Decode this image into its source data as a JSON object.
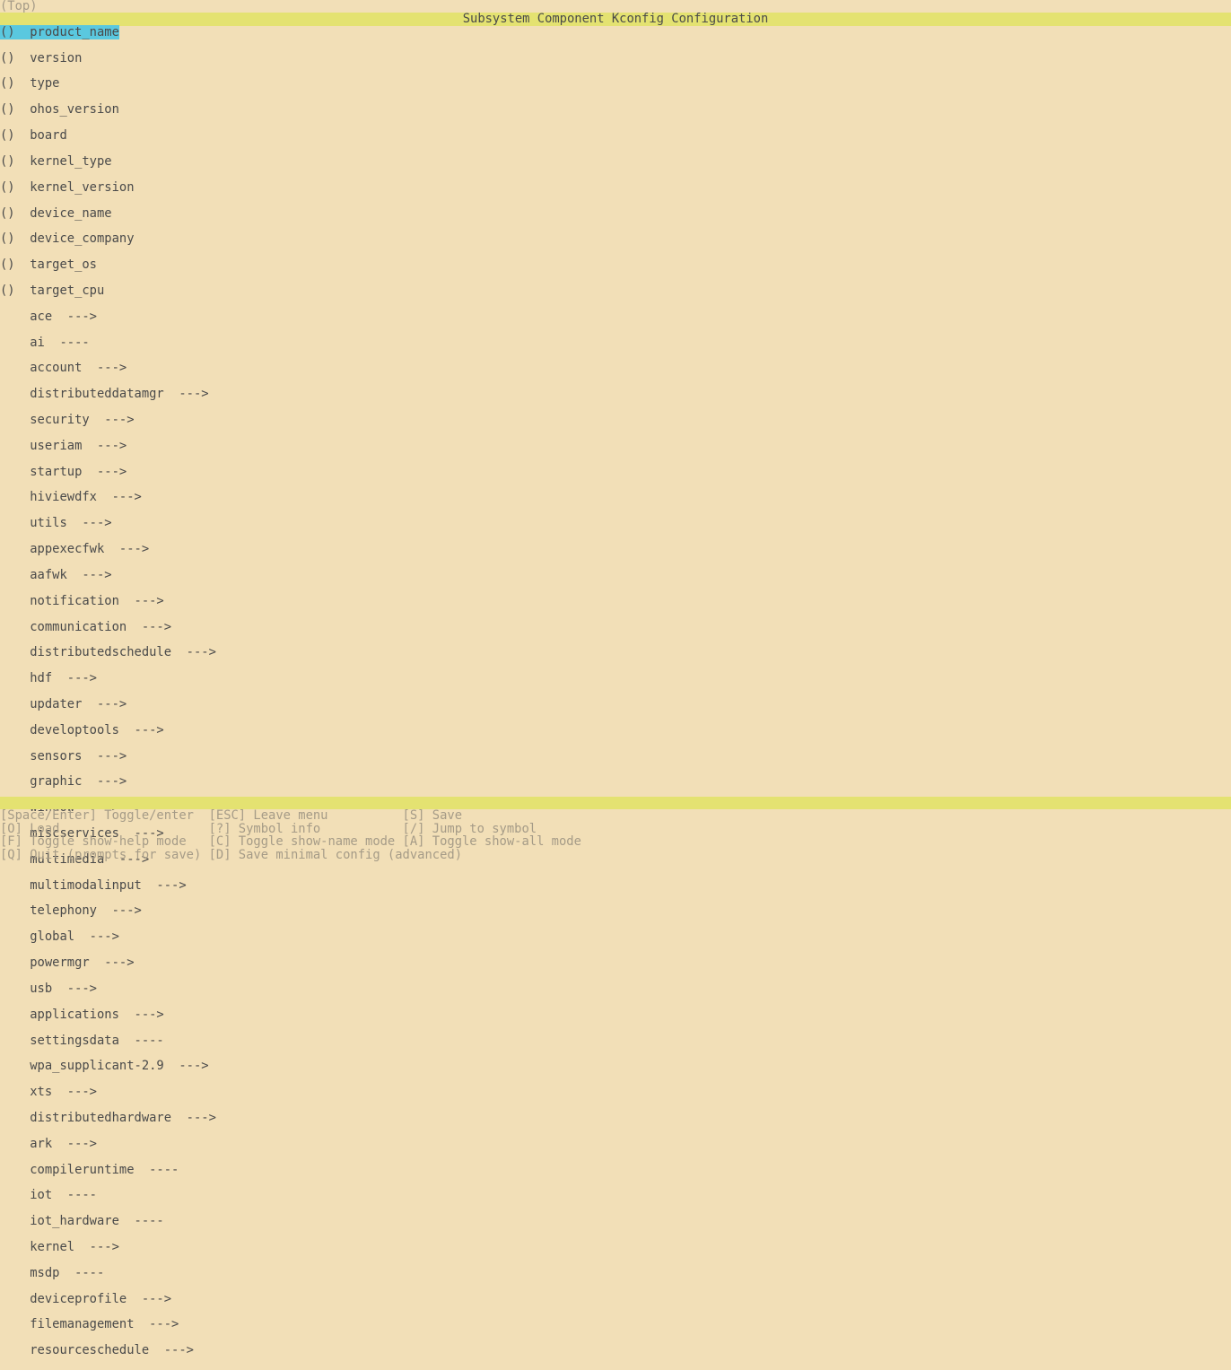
{
  "breadcrumb": "(Top)",
  "title": "Subsystem Component Kconfig Configuration",
  "string_items": [
    "product_name",
    "version",
    "type",
    "ohos_version",
    "board",
    "kernel_type",
    "kernel_version",
    "device_name",
    "device_company",
    "target_os",
    "target_cpu"
  ],
  "submenu_items": [
    {
      "name": "ace",
      "arrow": " --->"
    },
    {
      "name": "ai",
      "arrow": " ----"
    },
    {
      "name": "account",
      "arrow": " --->"
    },
    {
      "name": "distributeddatamgr",
      "arrow": " --->"
    },
    {
      "name": "security",
      "arrow": " --->"
    },
    {
      "name": "useriam",
      "arrow": " --->"
    },
    {
      "name": "startup",
      "arrow": " --->"
    },
    {
      "name": "hiviewdfx",
      "arrow": " --->"
    },
    {
      "name": "utils",
      "arrow": " --->"
    },
    {
      "name": "appexecfwk",
      "arrow": " --->"
    },
    {
      "name": "aafwk",
      "arrow": " --->"
    },
    {
      "name": "notification",
      "arrow": " --->"
    },
    {
      "name": "communication",
      "arrow": " --->"
    },
    {
      "name": "distributedschedule",
      "arrow": " --->"
    },
    {
      "name": "hdf",
      "arrow": " --->"
    },
    {
      "name": "updater",
      "arrow": " --->"
    },
    {
      "name": "developtools",
      "arrow": " --->"
    },
    {
      "name": "sensors",
      "arrow": " --->"
    },
    {
      "name": "graphic",
      "arrow": " --->"
    },
    {
      "name": "window",
      "arrow": " --->"
    },
    {
      "name": "miscservices",
      "arrow": " --->"
    },
    {
      "name": "multimedia",
      "arrow": " --->"
    },
    {
      "name": "multimodalinput",
      "arrow": " --->"
    },
    {
      "name": "telephony",
      "arrow": " --->"
    },
    {
      "name": "global",
      "arrow": " --->"
    },
    {
      "name": "powermgr",
      "arrow": " --->"
    },
    {
      "name": "usb",
      "arrow": " --->"
    },
    {
      "name": "applications",
      "arrow": " --->"
    },
    {
      "name": "settingsdata",
      "arrow": " ----"
    },
    {
      "name": "wpa_supplicant-2.9",
      "arrow": " --->"
    },
    {
      "name": "xts",
      "arrow": " --->"
    },
    {
      "name": "distributedhardware",
      "arrow": " --->"
    },
    {
      "name": "ark",
      "arrow": " --->"
    },
    {
      "name": "compileruntime",
      "arrow": " ----"
    },
    {
      "name": "iot",
      "arrow": " ----"
    },
    {
      "name": "iot_hardware",
      "arrow": " ----"
    },
    {
      "name": "kernel",
      "arrow": " --->"
    },
    {
      "name": "msdp",
      "arrow": " ----"
    },
    {
      "name": "deviceprofile",
      "arrow": " --->"
    },
    {
      "name": "filemanagement",
      "arrow": " --->"
    },
    {
      "name": "resourceschedule",
      "arrow": " --->"
    }
  ],
  "help_lines": [
    "[Space/Enter] Toggle/enter  [ESC] Leave menu          [S] Save",
    "[O] Load                    [?] Symbol info           [/] Jump to symbol",
    "[F] Toggle show-help mode   [C] Toggle show-name mode [A] Toggle show-all mode",
    "[Q] Quit (prompts for save) [D] Save minimal config (advanced)"
  ]
}
